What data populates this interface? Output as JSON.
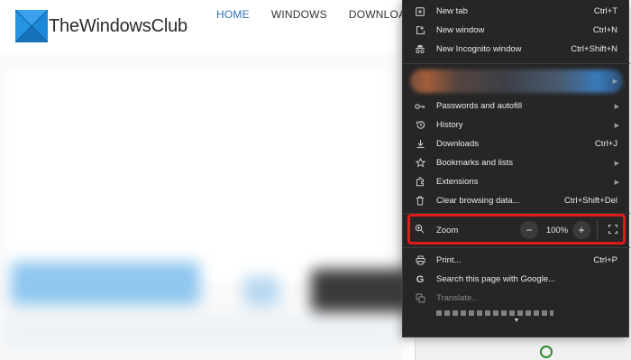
{
  "site": {
    "logo_text": "TheWindowsClub",
    "nav": [
      {
        "label": "HOME",
        "active": true
      },
      {
        "label": "WINDOWS",
        "active": false
      },
      {
        "label": "DOWNLOADS",
        "active": false
      }
    ]
  },
  "menu": {
    "top_items": [
      {
        "label": "New tab",
        "shortcut": "Ctrl+T",
        "icon": "new-tab-icon"
      },
      {
        "label": "New window",
        "shortcut": "Ctrl+N",
        "icon": "new-window-icon"
      },
      {
        "label": "New Incognito window",
        "shortcut": "Ctrl+Shift+N",
        "icon": "incognito-icon"
      }
    ],
    "mid_items": [
      {
        "label": "Passwords and autofill",
        "shortcut": "",
        "icon": "key-icon",
        "submenu": true
      },
      {
        "label": "History",
        "shortcut": "",
        "icon": "history-icon",
        "submenu": true
      },
      {
        "label": "Downloads",
        "shortcut": "Ctrl+J",
        "icon": "download-icon",
        "submenu": false
      },
      {
        "label": "Bookmarks and lists",
        "shortcut": "",
        "icon": "star-icon",
        "submenu": true
      },
      {
        "label": "Extensions",
        "shortcut": "",
        "icon": "extension-icon",
        "submenu": true
      },
      {
        "label": "Clear browsing data...",
        "shortcut": "Ctrl+Shift+Del",
        "icon": "trash-icon",
        "submenu": false
      }
    ],
    "zoom": {
      "label": "Zoom",
      "minus": "−",
      "value": "100%",
      "plus": "+"
    },
    "bottom_items": [
      {
        "label": "Print...",
        "shortcut": "Ctrl+P",
        "icon": "print-icon"
      },
      {
        "label": "Search this page with Google...",
        "shortcut": "",
        "icon": "google-icon"
      },
      {
        "label": "Translate...",
        "shortcut": "",
        "icon": "translate-icon",
        "disabled": true
      }
    ]
  },
  "colors": {
    "menu_bg": "#262626",
    "highlight": "#e01919",
    "nav_active": "#2f6fb8"
  }
}
